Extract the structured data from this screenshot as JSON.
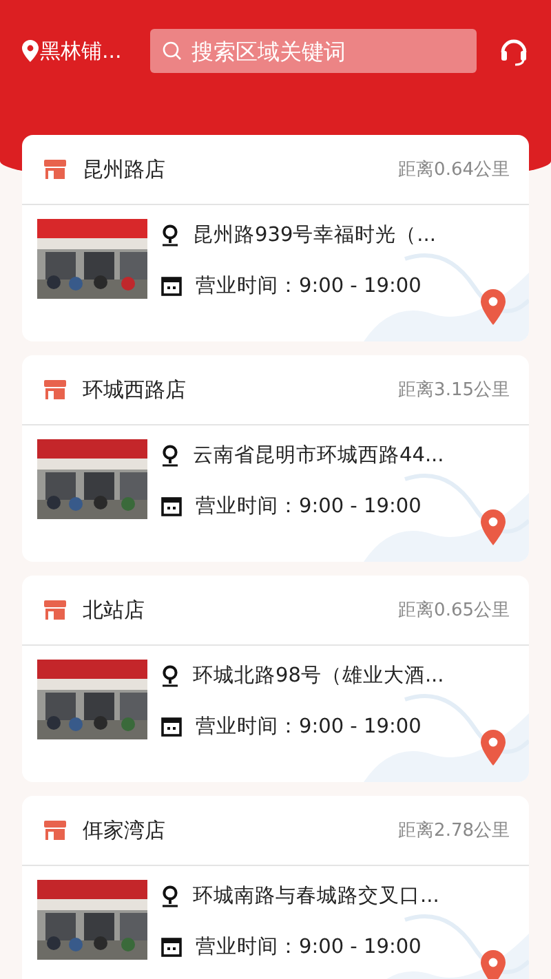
{
  "header": {
    "location": "黑林铺...",
    "search": {
      "placeholder": "搜索区域关键词"
    }
  },
  "stores": [
    {
      "name": "昆州路店",
      "distance": "距离0.64公里",
      "address": "昆州路939号幸福时光（...",
      "hours": "营业时间：9:00 - 19:00"
    },
    {
      "name": "环城西路店",
      "distance": "距离3.15公里",
      "address": "云南省昆明市环城西路44...",
      "hours": "营业时间：9:00 - 19:00"
    },
    {
      "name": "北站店",
      "distance": "距离0.65公里",
      "address": "环城北路98号（雄业大酒...",
      "hours": "营业时间：9:00 - 19:00"
    },
    {
      "name": "佴家湾店",
      "distance": "距离2.78公里",
      "address": "环城南路与春城路交叉口...",
      "hours": "营业时间：9:00 - 19:00"
    }
  ]
}
